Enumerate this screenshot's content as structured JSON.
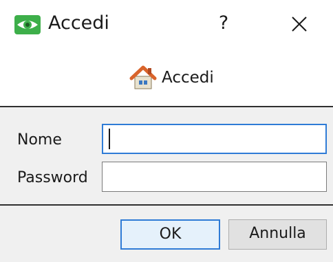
{
  "window": {
    "title": "Accedi",
    "help_label": "?",
    "icons": {
      "app": "eye-icon",
      "close": "close-icon",
      "header": "home-icon"
    },
    "colors": {
      "app_icon_green": "#3daf4a",
      "focus_blue": "#2e7bd6",
      "panel_gray": "#f0f0f0"
    }
  },
  "header": {
    "title": "Accedi"
  },
  "form": {
    "name_label": "Nome",
    "name_value": "",
    "password_label": "Password",
    "password_value": ""
  },
  "buttons": {
    "ok_label": "OK",
    "cancel_label": "Annulla"
  }
}
